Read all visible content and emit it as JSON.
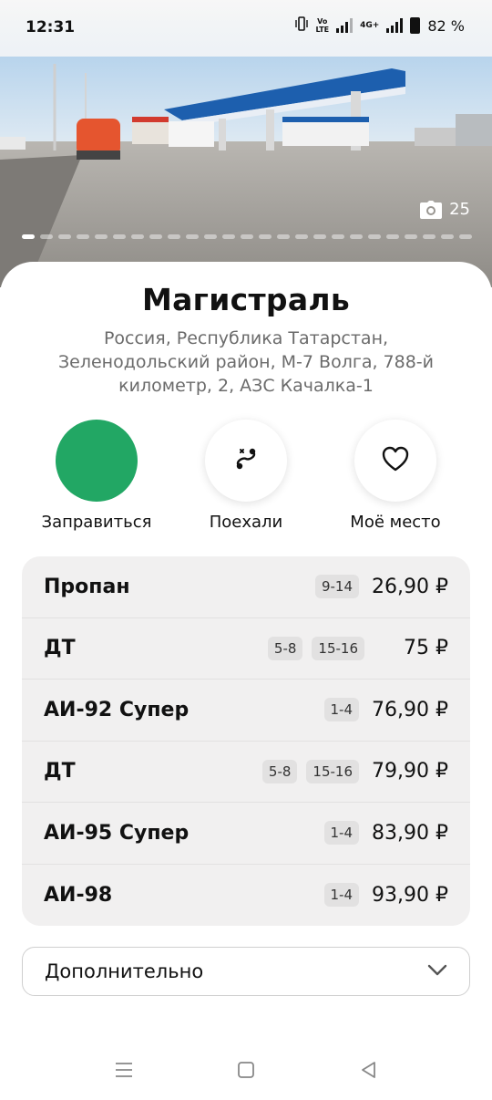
{
  "status_bar": {
    "time": "12:31",
    "volte_line1": "Vo",
    "volte_line2": "LTE",
    "network": "4G+",
    "battery": "82 %"
  },
  "photo": {
    "count": "25",
    "total_slides": 25,
    "active_slide": 1,
    "icon": "camera-icon"
  },
  "place": {
    "title": "Магистраль",
    "address": "Россия, Республика Татарстан, Зеленодольский район, М-7 Волга, 788-й километр, 2, АЗС Качалка-1"
  },
  "actions": [
    {
      "label": "Заправиться",
      "icon": "fuel-action-icon",
      "color": "#22a764"
    },
    {
      "label": "Поехали",
      "icon": "route-icon"
    },
    {
      "label": "Моё место",
      "icon": "heart-icon"
    }
  ],
  "prices": [
    {
      "name": "Пропан",
      "tags": [
        "9-14"
      ],
      "price": "26,90 ₽"
    },
    {
      "name": "ДТ",
      "tags": [
        "5-8",
        "15-16"
      ],
      "price": "75 ₽"
    },
    {
      "name": "АИ-92 Супер",
      "tags": [
        "1-4"
      ],
      "price": "76,90 ₽"
    },
    {
      "name": "ДТ",
      "tags": [
        "5-8",
        "15-16"
      ],
      "price": "79,90 ₽"
    },
    {
      "name": "АИ-95 Супер",
      "tags": [
        "1-4"
      ],
      "price": "83,90 ₽"
    },
    {
      "name": "АИ-98",
      "tags": [
        "1-4"
      ],
      "price": "93,90 ₽"
    }
  ],
  "more": {
    "label": "Дополнительно",
    "icon": "chevron-down-icon"
  },
  "nav_bar": {
    "icons": [
      "menu-icon",
      "home-icon",
      "back-icon"
    ]
  }
}
